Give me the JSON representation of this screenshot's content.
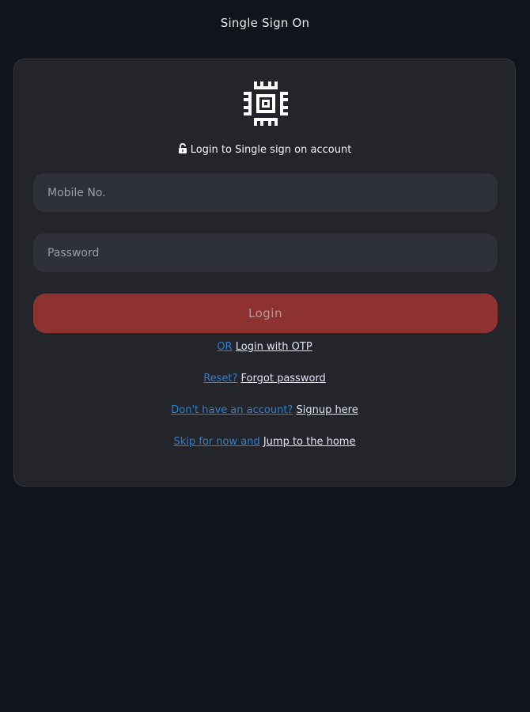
{
  "app": {
    "title": "Single Sign On"
  },
  "card": {
    "subtitle": "Login to Single sign on account",
    "mobile_placeholder": "Mobile No.",
    "password_placeholder": "Password",
    "login_label": "Login"
  },
  "links": {
    "otp_prefix": "OR",
    "otp_action": "Login with OTP",
    "reset_prefix": "Reset?",
    "reset_action": "Forgot password",
    "signup_prefix": "Don't have an account?",
    "signup_action": "Signup here",
    "skip_prefix": "Skip for now and",
    "skip_action": "Jump to the home"
  },
  "colors": {
    "background": "#11141b",
    "card": "#23252a",
    "input": "#2e3139",
    "login_button": "#8d3230",
    "link_prefix": "#2f7fd0",
    "link_action": "#dfe5f5"
  },
  "icons": {
    "logo": "circuit-chip-logo",
    "lock": "unlock-icon"
  }
}
